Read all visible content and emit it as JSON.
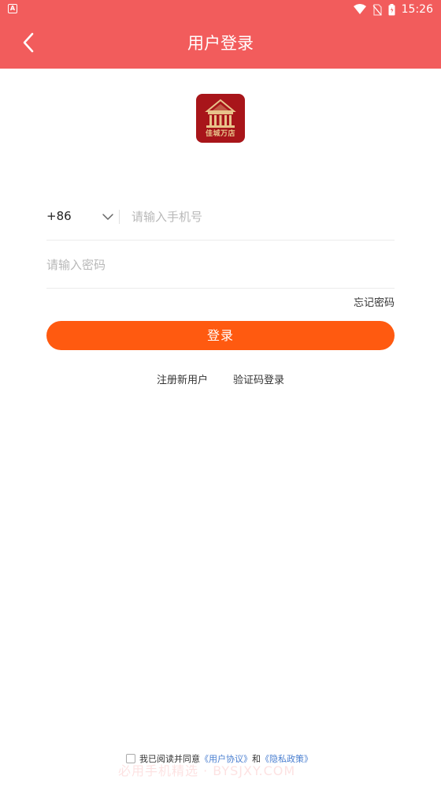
{
  "status_bar": {
    "left_icon_label": "A",
    "time": "15:26",
    "icons": [
      "wifi-icon",
      "no-sim-icon",
      "battery-icon"
    ]
  },
  "nav": {
    "title": "用户登录",
    "back_icon": "chevron-left-icon"
  },
  "logo": {
    "text": "佳城万店"
  },
  "form": {
    "country_code": "+86",
    "phone_placeholder": "请输入手机号",
    "phone_value": "",
    "password_placeholder": "请输入密码",
    "password_value": "",
    "forgot_label": "忘记密码",
    "login_label": "登录"
  },
  "links": {
    "register": "注册新用户",
    "sms_login": "验证码登录"
  },
  "agreement": {
    "prefix": "我已阅读并同意",
    "user_agreement": "《用户协议》",
    "and": "和",
    "privacy_policy": "《隐私政策》",
    "checked": false
  },
  "watermark": "必用手机精选 · BYSJXY.COM",
  "colors": {
    "header": "#f25c5c",
    "primary_button": "#ff5a10",
    "logo_bg": "#a8151a",
    "logo_gold": "#e8c38a",
    "link_blue": "#4a7fd0"
  }
}
